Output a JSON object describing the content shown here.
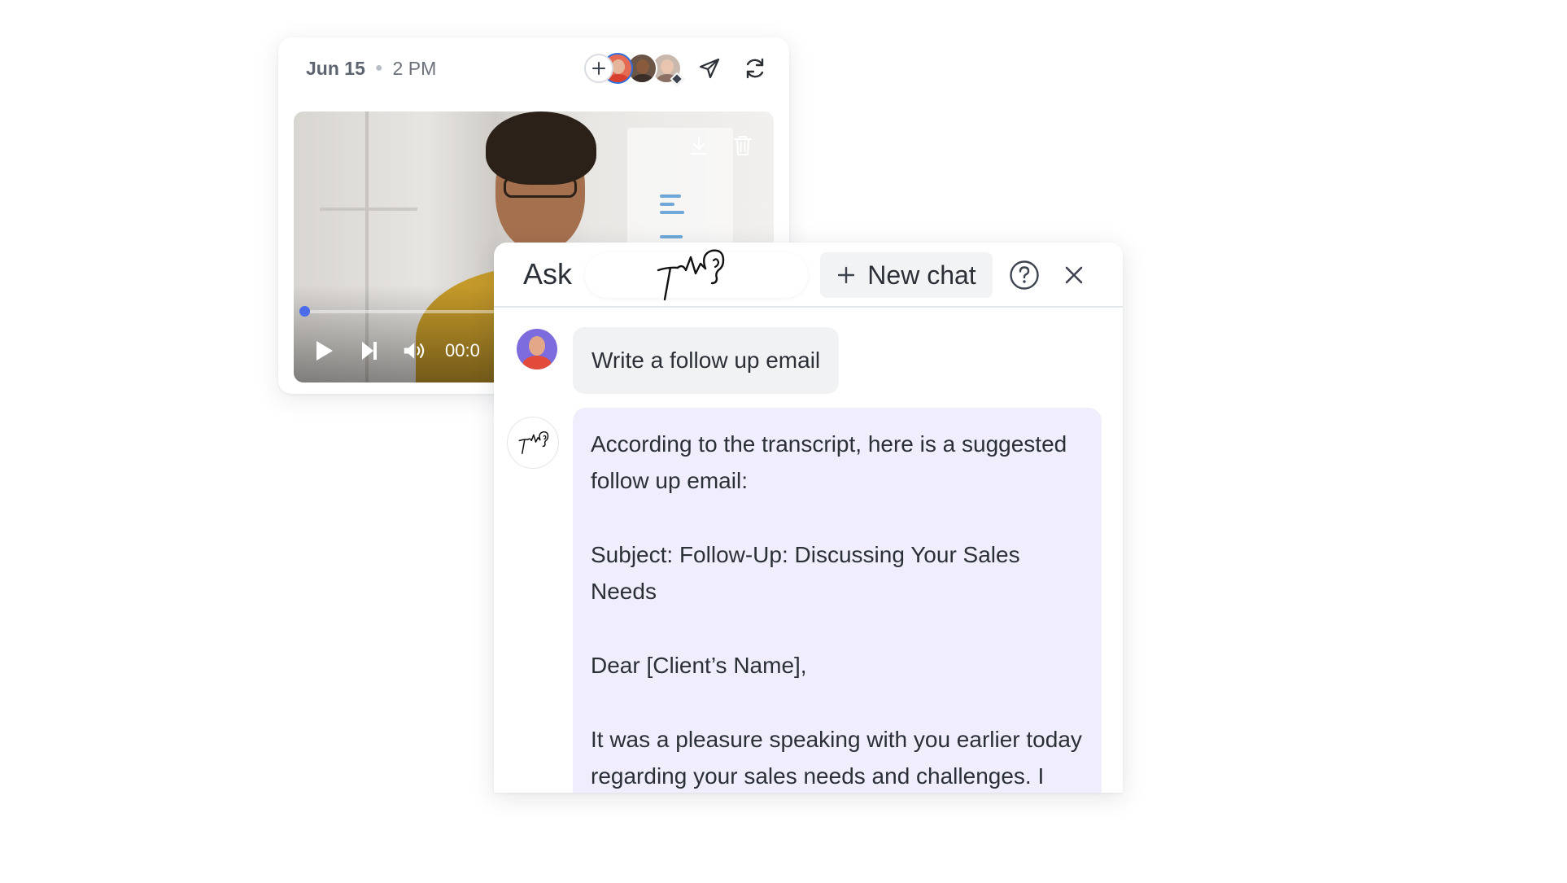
{
  "meeting": {
    "date": "Jun 15",
    "time": "2 PM",
    "video": {
      "time_display": "00:0",
      "progress_fraction": 0.01
    }
  },
  "ask_panel": {
    "title": "Ask",
    "new_chat_label": "New chat",
    "messages": {
      "user": "Write a follow up email",
      "assistant_lines": [
        "According to the transcript, here is a suggested follow up email:",
        "Subject: Follow-Up: Discussing Your Sales Needs",
        "Dear [Client’s Name],",
        "It was a pleasure speaking with you earlier today regarding your sales needs and challenges. I wanted to take a moment to summarize our"
      ]
    }
  },
  "icons": {
    "add": "plus-icon",
    "send": "paper-plane-icon",
    "refresh": "refresh-icon",
    "download": "download-icon",
    "delete": "trash-icon",
    "play": "play-icon",
    "next": "skip-forward-icon",
    "volume": "volume-icon",
    "help": "help-circle-icon",
    "close": "close-icon",
    "brand": "brand-logo-icon"
  },
  "colors": {
    "accent": "#4b6bea",
    "assistant_bubble": "#f0eefc",
    "user_bubble": "#f1f2f4"
  }
}
